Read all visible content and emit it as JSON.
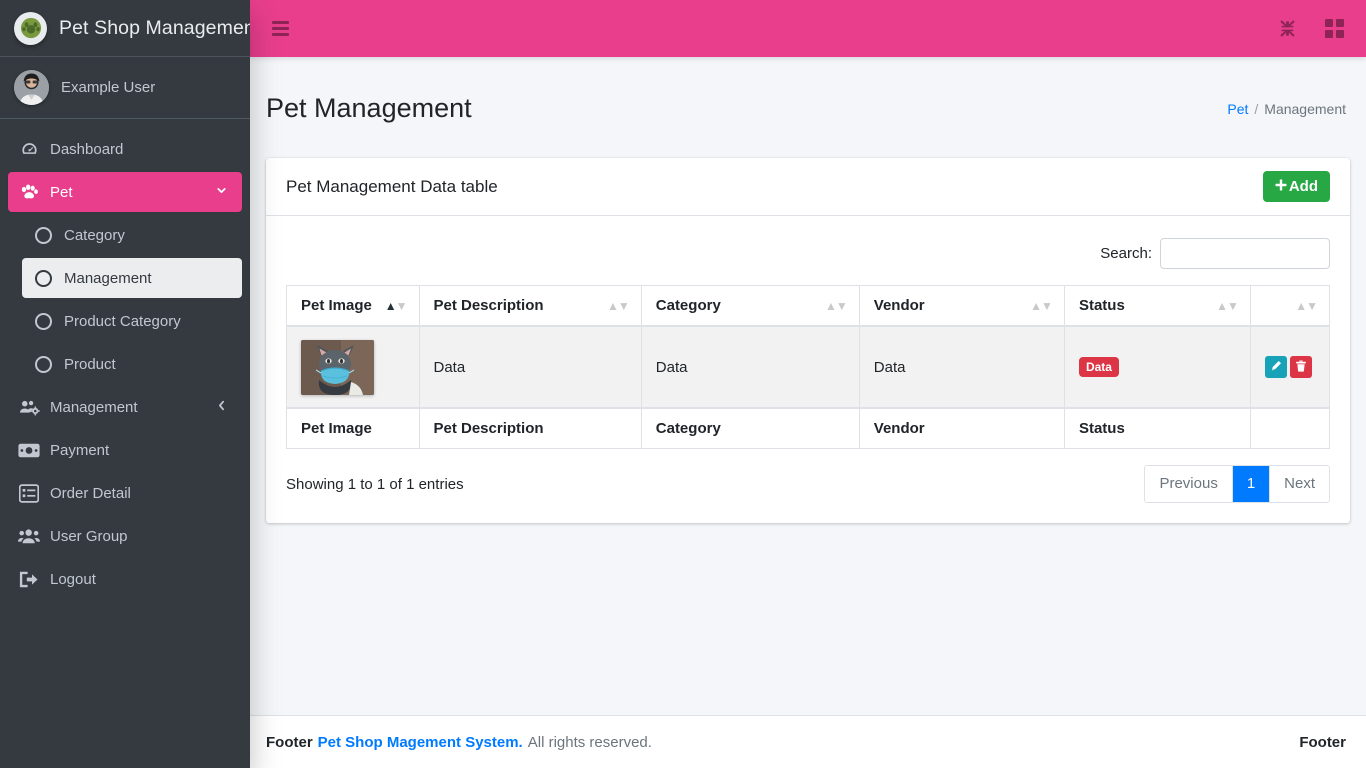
{
  "brand": {
    "title": "Pet Shop Management",
    "logo_icon": "paw-logo-icon"
  },
  "user": {
    "name": "Example User",
    "avatar_icon": "user-avatar"
  },
  "sidebar": {
    "items": [
      {
        "label": "Dashboard",
        "icon": "dashboard-icon",
        "state": "normal",
        "level": "top"
      },
      {
        "label": "Pet",
        "icon": "paw-icon",
        "state": "active-pink",
        "level": "top",
        "chevron": "⌄"
      },
      {
        "label": "Category",
        "icon": "circle-icon",
        "state": "normal",
        "level": "sub"
      },
      {
        "label": "Management",
        "icon": "circle-icon",
        "state": "active-light",
        "level": "sub"
      },
      {
        "label": "Product Category",
        "icon": "circle-icon",
        "state": "normal",
        "level": "sub"
      },
      {
        "label": "Product",
        "icon": "circle-icon",
        "state": "normal",
        "level": "sub"
      },
      {
        "label": "Management",
        "icon": "users-cog-icon",
        "state": "normal",
        "level": "top",
        "chevron": "‹"
      },
      {
        "label": "Payment",
        "icon": "money-bill-icon",
        "state": "normal",
        "level": "top"
      },
      {
        "label": "Order Detail",
        "icon": "list-alt-icon",
        "state": "normal",
        "level": "top"
      },
      {
        "label": "User Group",
        "icon": "users-icon",
        "state": "normal",
        "level": "top"
      },
      {
        "label": "Logout",
        "icon": "sign-out-icon",
        "state": "normal",
        "level": "top"
      }
    ]
  },
  "topbar": {
    "menu_toggle_icon": "hamburger-icon",
    "fullscreen_icon": "compress-arrows-icon",
    "apps_icon": "grid-apps-icon",
    "background_color": "#e83e8c"
  },
  "page": {
    "title": "Pet Management",
    "breadcrumb": {
      "parent": "Pet",
      "separator": "/",
      "current": "Management"
    }
  },
  "card": {
    "title": "Pet Management Data table",
    "add_button": {
      "label": "Add",
      "icon": "plus-icon",
      "color": "#28a745"
    }
  },
  "search": {
    "label": "Search:",
    "value": "",
    "placeholder": ""
  },
  "table": {
    "headers": [
      {
        "label": "Pet Image",
        "sort": "asc"
      },
      {
        "label": "Pet Description",
        "sort": "none"
      },
      {
        "label": "Category",
        "sort": "none"
      },
      {
        "label": "Vendor",
        "sort": "none"
      },
      {
        "label": "Status",
        "sort": "none"
      },
      {
        "label": "",
        "sort": "none"
      }
    ],
    "footers": [
      "Pet Image",
      "Pet Description",
      "Category",
      "Vendor",
      "Status",
      ""
    ],
    "rows": [
      {
        "image_alt": "cat-with-mask-photo",
        "description": "Data",
        "category": "Data",
        "vendor": "Data",
        "status": {
          "label": "Data",
          "color": "#dc3545"
        },
        "actions": [
          {
            "name": "edit-button",
            "icon": "pencil-icon",
            "color": "#17a2b8"
          },
          {
            "name": "delete-button",
            "icon": "trash-icon",
            "color": "#dc3545"
          }
        ]
      }
    ],
    "info": "Showing 1 to 1 of 1 entries",
    "pagination": {
      "previous": "Previous",
      "pages": [
        "1"
      ],
      "next": "Next",
      "active_page": "1",
      "active_color": "#007bff"
    }
  },
  "footer": {
    "label": "Footer",
    "link": "Pet Shop Magement System.",
    "copyright": "All rights reserved.",
    "right_label": "Footer"
  }
}
